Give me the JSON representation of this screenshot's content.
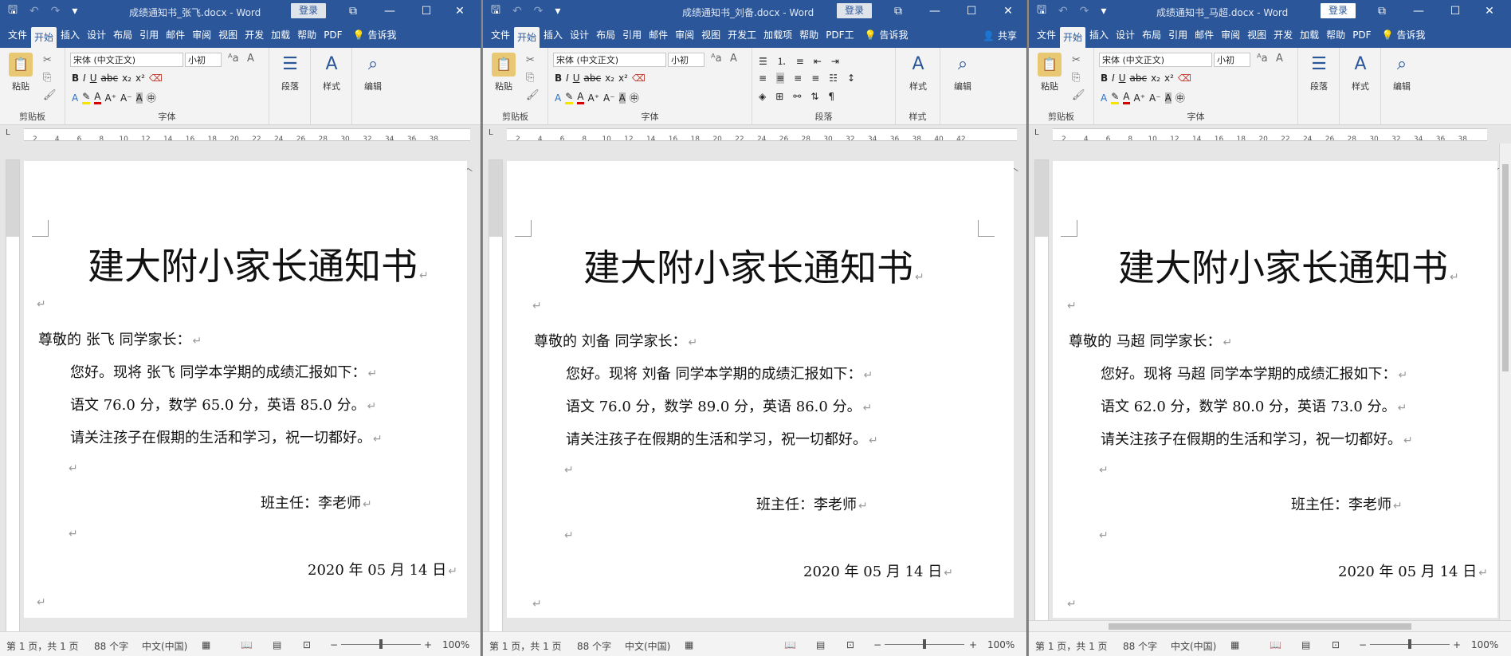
{
  "qat": {
    "save_icon": "save-icon",
    "undo_icon": "undo-icon",
    "redo_icon": "redo-icon",
    "customize_icon": "chevron-down-icon"
  },
  "login_label": "登录",
  "window_controls": {
    "restore": "⧉",
    "minimize": "—",
    "maximize": "☐",
    "close": "✕"
  },
  "ribbon_labels": {
    "paste": "粘贴",
    "clipboard": "剪贴板",
    "font_group": "字体",
    "paragraph_group": "段落",
    "paragraph_btn": "段落",
    "styles": "样式",
    "styles_group": "样式",
    "editing": "编辑",
    "font_name": "宋体 (中文正文)",
    "font_size": "小初",
    "bold": "B",
    "italic": "I",
    "underline": "U",
    "strike": "abc",
    "subscript": "x₂",
    "superscript": "x²",
    "share": "共享",
    "tell_me": "告诉我"
  },
  "ruler_ticks": [
    "L",
    "2",
    "4",
    "6",
    "8",
    "10",
    "12",
    "14",
    "16",
    "18",
    "20",
    "22",
    "24",
    "26",
    "28",
    "30",
    "32",
    "34",
    "36",
    "38",
    "40",
    "42"
  ],
  "windows": [
    {
      "title": "成绩通知书_张飞.docx - Word",
      "tabs": [
        "文件",
        "开始",
        "插入",
        "设计",
        "布局",
        "引用",
        "邮件",
        "审阅",
        "视图",
        "开发",
        "加载",
        "帮助",
        "PDF"
      ],
      "doc": {
        "title": "建大附小家长通知书",
        "greeting": "尊敬的  张飞  同学家长：",
        "intro": "您好。现将  张飞  同学本学期的成绩汇报如下：",
        "scores": "语文  76.0  分，数学  65.0  分，英语  85.0  分。",
        "closing": "请关注孩子在假期的生活和学习，祝一切都好。",
        "teacher": "班主任：李老师",
        "date": "2020 年 05 月 14 日"
      },
      "status": {
        "page": "第 1 页，共 1 页",
        "words": "88 个字",
        "lang": "中文(中国)",
        "zoom": "100%"
      }
    },
    {
      "title": "成绩通知书_刘备.docx - Word",
      "tabs": [
        "文件",
        "开始",
        "插入",
        "设计",
        "布局",
        "引用",
        "邮件",
        "审阅",
        "视图",
        "开发工",
        "加载项",
        "帮助",
        "PDF工"
      ],
      "doc": {
        "title": "建大附小家长通知书",
        "greeting": "尊敬的  刘备  同学家长：",
        "intro": "您好。现将  刘备  同学本学期的成绩汇报如下：",
        "scores": "语文  76.0  分，数学  89.0  分，英语  86.0  分。",
        "closing": "请关注孩子在假期的生活和学习，祝一切都好。",
        "teacher": "班主任：李老师",
        "date": "2020 年 05 月 14 日"
      },
      "status": {
        "page": "第 1 页，共 1 页",
        "words": "88 个字",
        "lang": "中文(中国)",
        "zoom": "100%"
      }
    },
    {
      "title": "成绩通知书_马超.docx - Word",
      "tabs": [
        "文件",
        "开始",
        "插入",
        "设计",
        "布局",
        "引用",
        "邮件",
        "审阅",
        "视图",
        "开发",
        "加载",
        "帮助",
        "PDF"
      ],
      "doc": {
        "title": "建大附小家长通知书",
        "greeting": "尊敬的  马超  同学家长：",
        "intro": "您好。现将  马超  同学本学期的成绩汇报如下：",
        "scores": "语文  62.0  分，数学  80.0  分，英语  73.0  分。",
        "closing": "请关注孩子在假期的生活和学习，祝一切都好。",
        "teacher": "班主任：李老师",
        "date": "2020 年 05 月 14 日"
      },
      "status": {
        "page": "第 1 页，共 1 页",
        "words": "88 个字",
        "lang": "中文(中国)",
        "zoom": "100%"
      }
    }
  ],
  "paragraph_mark": "↵"
}
